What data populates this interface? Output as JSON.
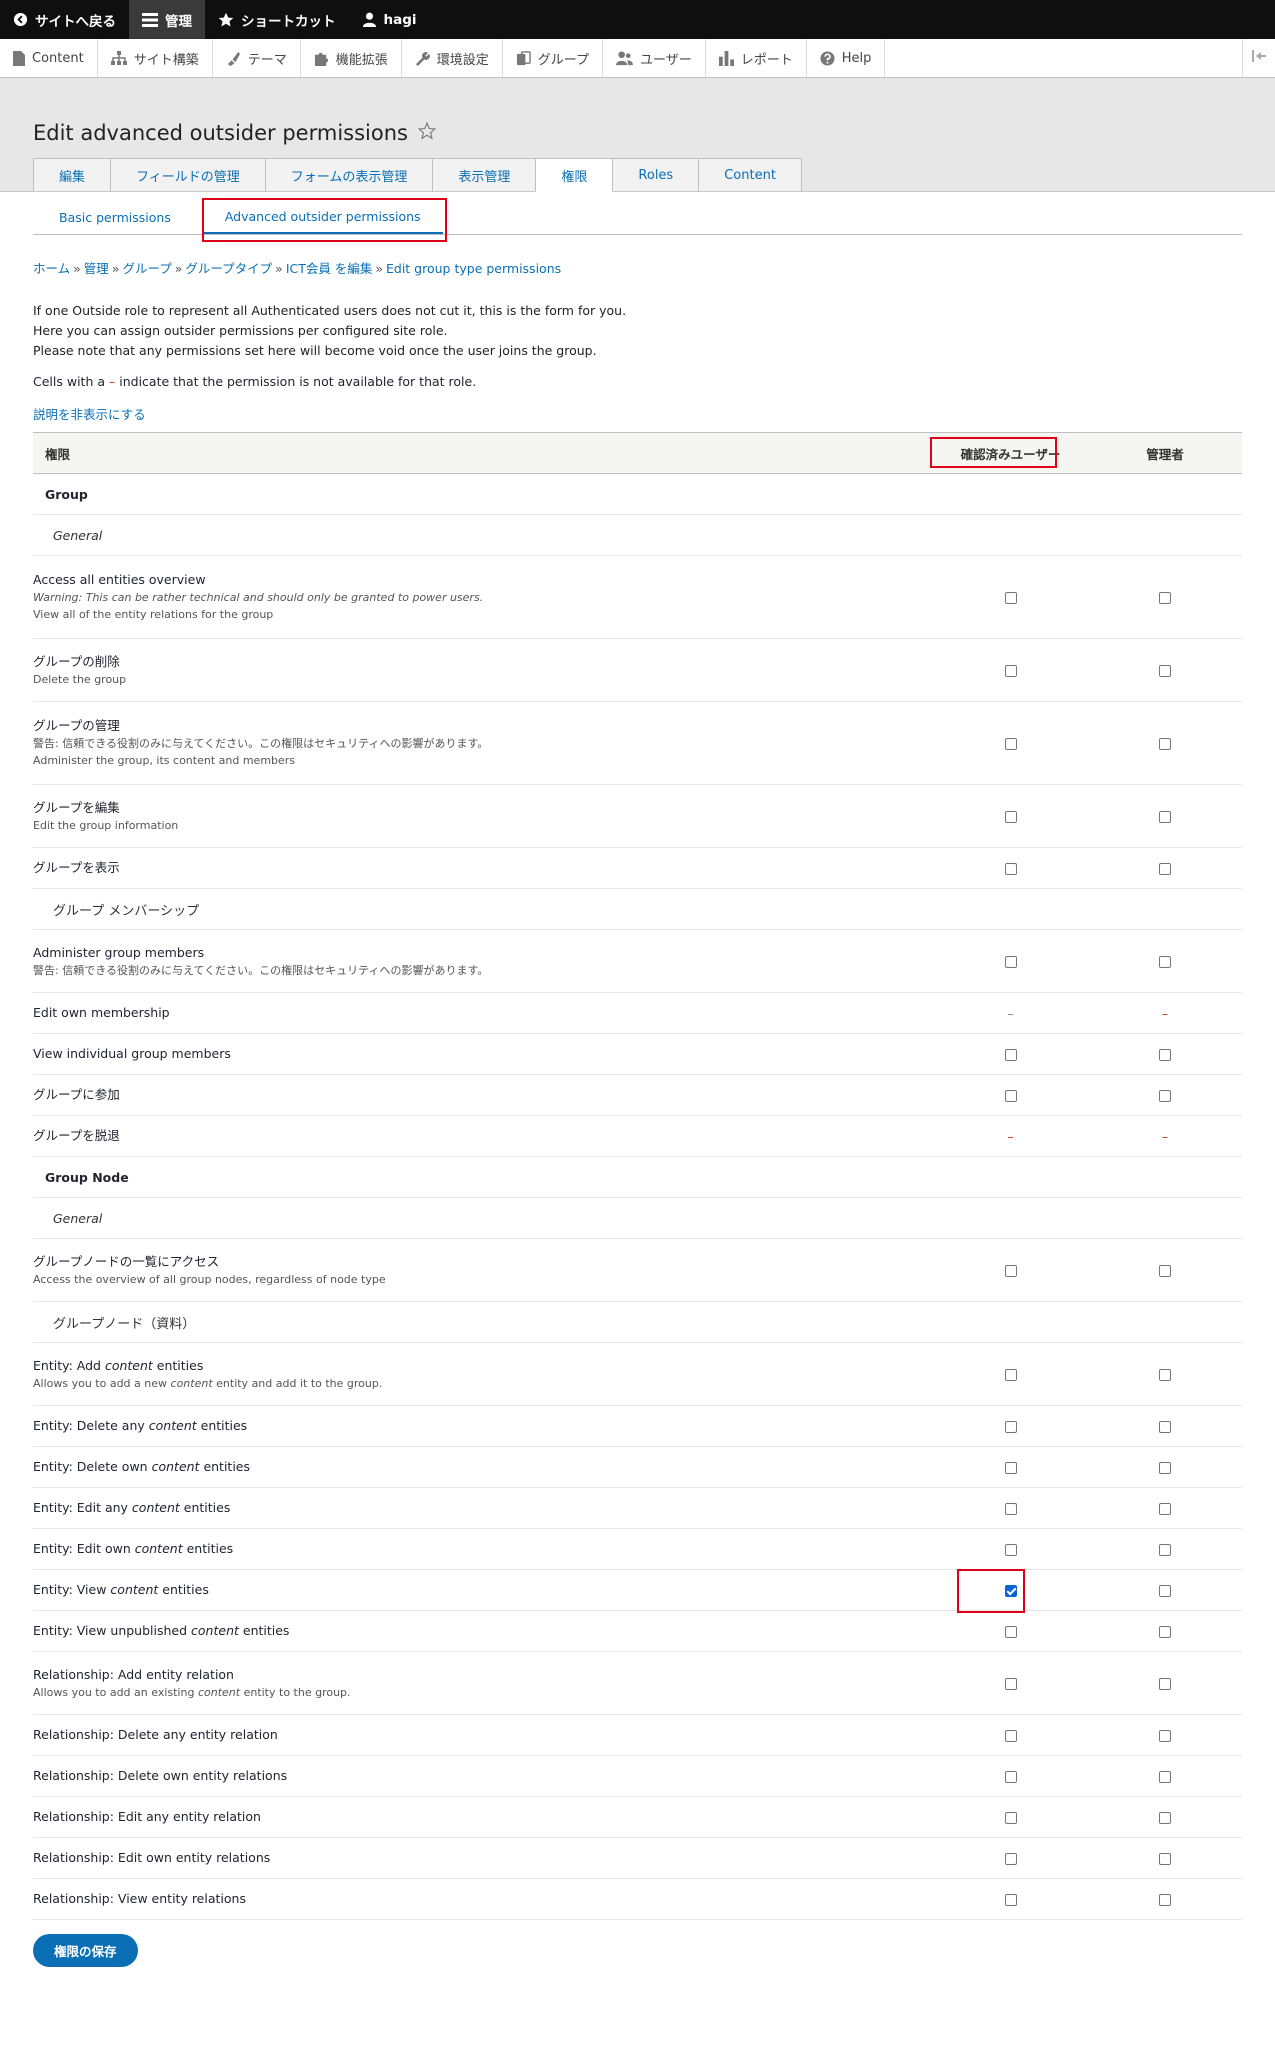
{
  "toolbar": {
    "back": "サイトへ戻る",
    "manage": "管理",
    "shortcuts": "ショートカット",
    "user": "hagi"
  },
  "tray": {
    "items": [
      "Content",
      "サイト構築",
      "テーマ",
      "機能拡張",
      "環境設定",
      "グループ",
      "ユーザー",
      "レポート",
      "Help"
    ]
  },
  "page": {
    "title": "Edit advanced outsider permissions",
    "primary_tabs": [
      "編集",
      "フィールドの管理",
      "フォームの表示管理",
      "表示管理",
      "権限",
      "Roles",
      "Content"
    ],
    "secondary_tabs": [
      "Basic permissions",
      "Advanced outsider permissions"
    ],
    "breadcrumb": [
      "ホーム",
      "管理",
      "グループ",
      "グループタイプ",
      "ICT会員 を編集",
      "Edit group type permissions"
    ],
    "breadcrumb_sep": "»",
    "intro": [
      "If one Outside role to represent all Authenticated users does not cut it, this is the form for you.",
      "Here you can assign outsider permissions per configured site role.",
      "Please note that any permissions set here will become void once the user joins the group."
    ],
    "legend_pre": "Cells with a",
    "legend_dash": "–",
    "legend_post": "indicate that the permission is not available for that role.",
    "toggle_desc": "説明を非表示にする",
    "save_button": "権限の保存"
  },
  "table": {
    "headers": {
      "permission": "権限",
      "role_a": "確認済みユーザー",
      "role_b": "管理者"
    },
    "module_group": "Group",
    "section_general": "General",
    "module_group_node": "Group Node",
    "provider_membership": "グループ メンバーシップ",
    "provider_node": "グループノード（資料）",
    "rows": {
      "access_overview": {
        "name": "Access all entities overview",
        "warn": "Warning: This can be rather technical and should only be granted to power users.",
        "desc": "View all of the entity relations for the group"
      },
      "delete_group": {
        "name": "グループの削除",
        "desc": "Delete the group"
      },
      "administer_group": {
        "name": "グループの管理",
        "warn": "警告: 信頼できる役割のみに与えてください。この権限はセキュリティへの影響があります。",
        "desc": "Administer the group, its content and members"
      },
      "edit_group": {
        "name": "グループを編集",
        "desc": "Edit the group information"
      },
      "view_group": {
        "name": "グループを表示"
      },
      "administer_members": {
        "name": "Administer group members",
        "warn": "警告: 信頼できる役割のみに与えてください。この権限はセキュリティへの影響があります。"
      },
      "edit_own_membership": {
        "name": "Edit own membership"
      },
      "view_members": {
        "name": "View individual group members"
      },
      "join_group": {
        "name": "グループに参加"
      },
      "leave_group": {
        "name": "グループを脱退"
      },
      "access_node_overview": {
        "name": "グループノードの一覧にアクセス",
        "desc": "Access the overview of all group nodes, regardless of node type"
      },
      "entity_add": {
        "pre": "Entity: Add",
        "em": "content",
        "post": "entities",
        "desc_pre": "Allows you to add a new",
        "desc_em": "content",
        "desc_post": "entity and add it to the group."
      },
      "entity_delete_any": {
        "pre": "Entity: Delete any",
        "em": "content",
        "post": "entities"
      },
      "entity_delete_own": {
        "pre": "Entity: Delete own",
        "em": "content",
        "post": "entities"
      },
      "entity_edit_any": {
        "pre": "Entity: Edit any",
        "em": "content",
        "post": "entities"
      },
      "entity_edit_own": {
        "pre": "Entity: Edit own",
        "em": "content",
        "post": "entities"
      },
      "entity_view": {
        "pre": "Entity: View",
        "em": "content",
        "post": "entities"
      },
      "entity_view_unpublished": {
        "pre": "Entity: View unpublished",
        "em": "content",
        "post": "entities"
      },
      "rel_add": {
        "name": "Relationship: Add entity relation",
        "desc_pre": "Allows you to add an existing",
        "desc_em": "content",
        "desc_post": "entity to the group."
      },
      "rel_delete_any": {
        "name": "Relationship: Delete any entity relation"
      },
      "rel_delete_own": {
        "name": "Relationship: Delete own entity relations"
      },
      "rel_edit_any": {
        "name": "Relationship: Edit any entity relation"
      },
      "rel_edit_own": {
        "name": "Relationship: Edit own entity relations"
      },
      "rel_view": {
        "name": "Relationship: View entity relations"
      }
    },
    "na_mark": "–"
  },
  "colors": {
    "link": "#0a6fb4",
    "highlight": "#e0001a",
    "toolbar_bg": "#0f0f0f",
    "checked": "#0a64d6"
  }
}
